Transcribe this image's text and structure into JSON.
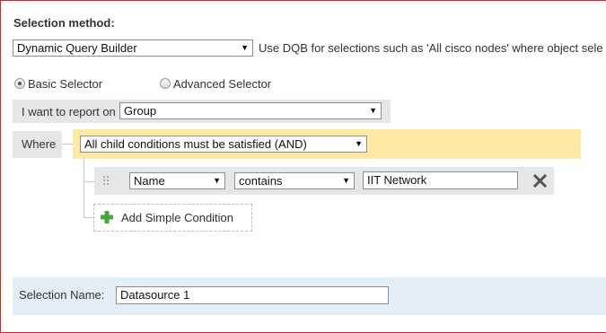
{
  "selection_method": {
    "title": "Selection method:",
    "dropdown_value": "Dynamic Query Builder",
    "hint": "Use DQB for selections such as 'All cisco nodes' where object sele"
  },
  "selector_mode": {
    "basic_label": "Basic Selector",
    "advanced_label": "Advanced Selector",
    "selected": "Basic Selector"
  },
  "report_on": {
    "label": "I want to report on",
    "value": "Group"
  },
  "where": {
    "label": "Where",
    "condition_mode": "All child conditions must be satisfied (AND)"
  },
  "condition": {
    "field": "Name",
    "operator": "contains",
    "value": "IIT Network"
  },
  "add_condition": {
    "label": "Add Simple Condition"
  },
  "selection_name": {
    "label": "Selection Name:",
    "value": "Datasource 1"
  },
  "colors": {
    "where_band": "#fde9a1",
    "condition_row": "#e6e6e6",
    "label_box": "#e6e6e6",
    "name_band": "#e3eef7",
    "add_icon": "#45a63b",
    "remove_icon": "#555555"
  }
}
